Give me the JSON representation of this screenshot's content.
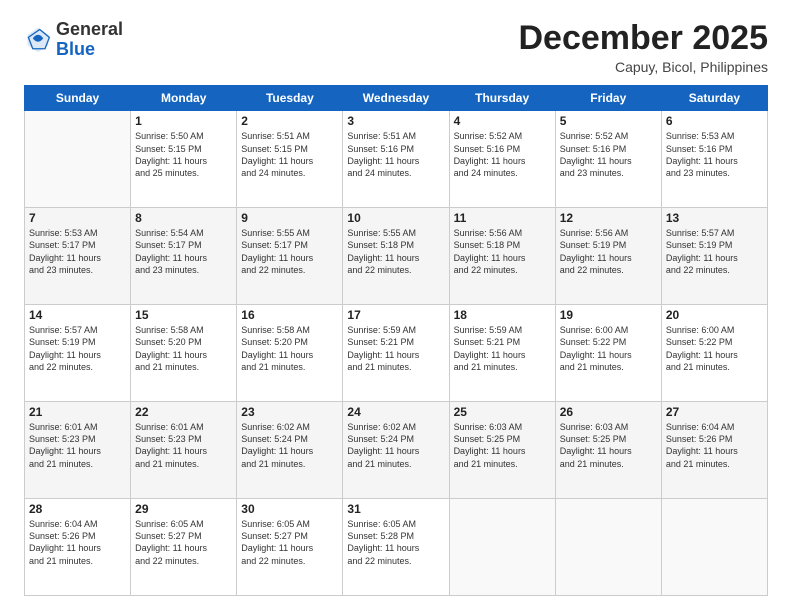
{
  "header": {
    "logo_general": "General",
    "logo_blue": "Blue",
    "month_title": "December 2025",
    "subtitle": "Capuy, Bicol, Philippines"
  },
  "calendar": {
    "days_of_week": [
      "Sunday",
      "Monday",
      "Tuesday",
      "Wednesday",
      "Thursday",
      "Friday",
      "Saturday"
    ],
    "weeks": [
      [
        {
          "day": "",
          "info": ""
        },
        {
          "day": "1",
          "info": "Sunrise: 5:50 AM\nSunset: 5:15 PM\nDaylight: 11 hours\nand 25 minutes."
        },
        {
          "day": "2",
          "info": "Sunrise: 5:51 AM\nSunset: 5:15 PM\nDaylight: 11 hours\nand 24 minutes."
        },
        {
          "day": "3",
          "info": "Sunrise: 5:51 AM\nSunset: 5:16 PM\nDaylight: 11 hours\nand 24 minutes."
        },
        {
          "day": "4",
          "info": "Sunrise: 5:52 AM\nSunset: 5:16 PM\nDaylight: 11 hours\nand 24 minutes."
        },
        {
          "day": "5",
          "info": "Sunrise: 5:52 AM\nSunset: 5:16 PM\nDaylight: 11 hours\nand 23 minutes."
        },
        {
          "day": "6",
          "info": "Sunrise: 5:53 AM\nSunset: 5:16 PM\nDaylight: 11 hours\nand 23 minutes."
        }
      ],
      [
        {
          "day": "7",
          "info": "Sunrise: 5:53 AM\nSunset: 5:17 PM\nDaylight: 11 hours\nand 23 minutes."
        },
        {
          "day": "8",
          "info": "Sunrise: 5:54 AM\nSunset: 5:17 PM\nDaylight: 11 hours\nand 23 minutes."
        },
        {
          "day": "9",
          "info": "Sunrise: 5:55 AM\nSunset: 5:17 PM\nDaylight: 11 hours\nand 22 minutes."
        },
        {
          "day": "10",
          "info": "Sunrise: 5:55 AM\nSunset: 5:18 PM\nDaylight: 11 hours\nand 22 minutes."
        },
        {
          "day": "11",
          "info": "Sunrise: 5:56 AM\nSunset: 5:18 PM\nDaylight: 11 hours\nand 22 minutes."
        },
        {
          "day": "12",
          "info": "Sunrise: 5:56 AM\nSunset: 5:19 PM\nDaylight: 11 hours\nand 22 minutes."
        },
        {
          "day": "13",
          "info": "Sunrise: 5:57 AM\nSunset: 5:19 PM\nDaylight: 11 hours\nand 22 minutes."
        }
      ],
      [
        {
          "day": "14",
          "info": "Sunrise: 5:57 AM\nSunset: 5:19 PM\nDaylight: 11 hours\nand 22 minutes."
        },
        {
          "day": "15",
          "info": "Sunrise: 5:58 AM\nSunset: 5:20 PM\nDaylight: 11 hours\nand 21 minutes."
        },
        {
          "day": "16",
          "info": "Sunrise: 5:58 AM\nSunset: 5:20 PM\nDaylight: 11 hours\nand 21 minutes."
        },
        {
          "day": "17",
          "info": "Sunrise: 5:59 AM\nSunset: 5:21 PM\nDaylight: 11 hours\nand 21 minutes."
        },
        {
          "day": "18",
          "info": "Sunrise: 5:59 AM\nSunset: 5:21 PM\nDaylight: 11 hours\nand 21 minutes."
        },
        {
          "day": "19",
          "info": "Sunrise: 6:00 AM\nSunset: 5:22 PM\nDaylight: 11 hours\nand 21 minutes."
        },
        {
          "day": "20",
          "info": "Sunrise: 6:00 AM\nSunset: 5:22 PM\nDaylight: 11 hours\nand 21 minutes."
        }
      ],
      [
        {
          "day": "21",
          "info": "Sunrise: 6:01 AM\nSunset: 5:23 PM\nDaylight: 11 hours\nand 21 minutes."
        },
        {
          "day": "22",
          "info": "Sunrise: 6:01 AM\nSunset: 5:23 PM\nDaylight: 11 hours\nand 21 minutes."
        },
        {
          "day": "23",
          "info": "Sunrise: 6:02 AM\nSunset: 5:24 PM\nDaylight: 11 hours\nand 21 minutes."
        },
        {
          "day": "24",
          "info": "Sunrise: 6:02 AM\nSunset: 5:24 PM\nDaylight: 11 hours\nand 21 minutes."
        },
        {
          "day": "25",
          "info": "Sunrise: 6:03 AM\nSunset: 5:25 PM\nDaylight: 11 hours\nand 21 minutes."
        },
        {
          "day": "26",
          "info": "Sunrise: 6:03 AM\nSunset: 5:25 PM\nDaylight: 11 hours\nand 21 minutes."
        },
        {
          "day": "27",
          "info": "Sunrise: 6:04 AM\nSunset: 5:26 PM\nDaylight: 11 hours\nand 21 minutes."
        }
      ],
      [
        {
          "day": "28",
          "info": "Sunrise: 6:04 AM\nSunset: 5:26 PM\nDaylight: 11 hours\nand 21 minutes."
        },
        {
          "day": "29",
          "info": "Sunrise: 6:05 AM\nSunset: 5:27 PM\nDaylight: 11 hours\nand 22 minutes."
        },
        {
          "day": "30",
          "info": "Sunrise: 6:05 AM\nSunset: 5:27 PM\nDaylight: 11 hours\nand 22 minutes."
        },
        {
          "day": "31",
          "info": "Sunrise: 6:05 AM\nSunset: 5:28 PM\nDaylight: 11 hours\nand 22 minutes."
        },
        {
          "day": "",
          "info": ""
        },
        {
          "day": "",
          "info": ""
        },
        {
          "day": "",
          "info": ""
        }
      ]
    ]
  }
}
